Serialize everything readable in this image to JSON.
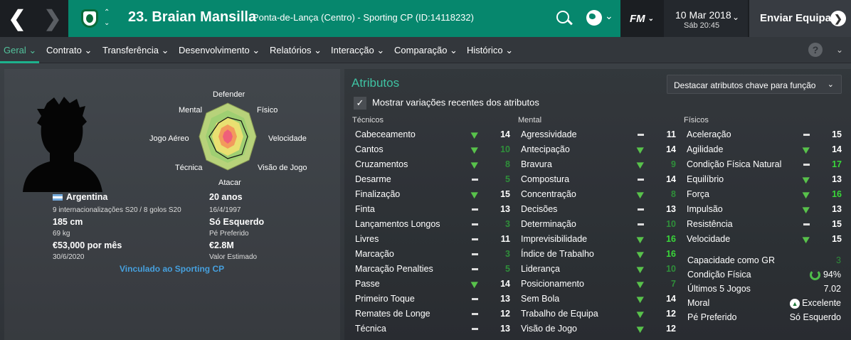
{
  "header": {
    "player_title": "23. Braian Mansilla",
    "player_subtitle": "Ponta-de-Lança (Centro) - Sporting CP (ID:14118232)",
    "fm_label": "FM",
    "date": "10 Mar 2018",
    "time": "Sáb 20:45",
    "send_label": "Enviar Equipa"
  },
  "menu": [
    {
      "label": "Geral"
    },
    {
      "label": "Contrato"
    },
    {
      "label": "Transferência"
    },
    {
      "label": "Desenvolvimento"
    },
    {
      "label": "Relatórios"
    },
    {
      "label": "Interacção"
    },
    {
      "label": "Comparação"
    },
    {
      "label": "Histórico"
    }
  ],
  "help": "?",
  "radar_labels": {
    "top": "Defender",
    "tl": "Mental",
    "tr": "Físico",
    "l": "Jogo Aéreo",
    "r": "Velocidade",
    "bl": "Técnica",
    "br": "Visão de Jogo",
    "bottom": "Atacar"
  },
  "profile": {
    "nation": "Argentina",
    "caps": "9 internacionalizações S20 / 8 golos S20",
    "height": "185 cm",
    "weight": "69 kg",
    "wage": "€53,000 por mês",
    "contract": "30/6/2020",
    "age": "20 anos",
    "dob": "16/4/1997",
    "foot": "Só Esquerdo",
    "foot_label": "Pé Preferido",
    "value": "€2.8M",
    "value_label": "Valor Estimado",
    "linked": "Vinculado ao Sporting CP"
  },
  "attributes": {
    "title": "Atributos",
    "highlight": "Destacar atributos chave para função",
    "show_changes": "Mostrar variações recentes dos atributos",
    "headers": [
      "Técnicos",
      "Mental",
      "Físicos"
    ],
    "technical": [
      {
        "name": "Cabeceamento",
        "value": "14",
        "trend": "up",
        "color": "#ffffff"
      },
      {
        "name": "Cantos",
        "value": "10",
        "trend": "up",
        "color": "#2f8f3a"
      },
      {
        "name": "Cruzamentos",
        "value": "8",
        "trend": "up",
        "color": "#2f8f3a"
      },
      {
        "name": "Desarme",
        "value": "5",
        "trend": "flat",
        "color": "#2f8f3a"
      },
      {
        "name": "Finalização",
        "value": "15",
        "trend": "up",
        "color": "#ffffff"
      },
      {
        "name": "Finta",
        "value": "13",
        "trend": "flat",
        "color": "#ffffff"
      },
      {
        "name": "Lançamentos Longos",
        "value": "3",
        "trend": "flat",
        "color": "#2f8f3a"
      },
      {
        "name": "Livres",
        "value": "11",
        "trend": "flat",
        "color": "#ffffff"
      },
      {
        "name": "Marcação",
        "value": "3",
        "trend": "flat",
        "color": "#2f8f3a"
      },
      {
        "name": "Marcação Penalties",
        "value": "5",
        "trend": "flat",
        "color": "#2f8f3a"
      },
      {
        "name": "Passe",
        "value": "14",
        "trend": "up",
        "color": "#ffffff"
      },
      {
        "name": "Primeiro Toque",
        "value": "13",
        "trend": "flat",
        "color": "#ffffff"
      },
      {
        "name": "Remates de Longe",
        "value": "12",
        "trend": "flat",
        "color": "#ffffff"
      },
      {
        "name": "Técnica",
        "value": "13",
        "trend": "flat",
        "color": "#ffffff"
      }
    ],
    "mental": [
      {
        "name": "Agressividade",
        "value": "11",
        "trend": "flat",
        "color": "#ffffff"
      },
      {
        "name": "Antecipação",
        "value": "14",
        "trend": "up",
        "color": "#ffffff"
      },
      {
        "name": "Bravura",
        "value": "9",
        "trend": "up",
        "color": "#2f8f3a"
      },
      {
        "name": "Compostura",
        "value": "14",
        "trend": "flat",
        "color": "#ffffff"
      },
      {
        "name": "Concentração",
        "value": "8",
        "trend": "up",
        "color": "#2f8f3a"
      },
      {
        "name": "Decisões",
        "value": "13",
        "trend": "flat",
        "color": "#ffffff"
      },
      {
        "name": "Determinação",
        "value": "10",
        "trend": "flat",
        "color": "#2f8f3a"
      },
      {
        "name": "Imprevisibilidade",
        "value": "16",
        "trend": "up",
        "color": "#39d739"
      },
      {
        "name": "Índice de Trabalho",
        "value": "16",
        "trend": "up",
        "color": "#39d739"
      },
      {
        "name": "Liderança",
        "value": "10",
        "trend": "up",
        "color": "#2f8f3a"
      },
      {
        "name": "Posicionamento",
        "value": "7",
        "trend": "up",
        "color": "#2f8f3a"
      },
      {
        "name": "Sem Bola",
        "value": "14",
        "trend": "up",
        "color": "#ffffff"
      },
      {
        "name": "Trabalho de Equipa",
        "value": "12",
        "trend": "up",
        "color": "#ffffff"
      },
      {
        "name": "Visão de Jogo",
        "value": "12",
        "trend": "up",
        "color": "#ffffff"
      }
    ],
    "physical": [
      {
        "name": "Aceleração",
        "value": "15",
        "trend": "flat",
        "color": "#ffffff"
      },
      {
        "name": "Agilidade",
        "value": "14",
        "trend": "up",
        "color": "#ffffff"
      },
      {
        "name": "Condição Física Natural",
        "value": "17",
        "trend": "flat",
        "color": "#39d739"
      },
      {
        "name": "Equilíbrio",
        "value": "13",
        "trend": "up",
        "color": "#ffffff"
      },
      {
        "name": "Força",
        "value": "16",
        "trend": "up",
        "color": "#39d739"
      },
      {
        "name": "Impulsão",
        "value": "13",
        "trend": "up",
        "color": "#ffffff"
      },
      {
        "name": "Resistência",
        "value": "15",
        "trend": "flat",
        "color": "#ffffff"
      },
      {
        "name": "Velocidade",
        "value": "15",
        "trend": "up",
        "color": "#ffffff"
      }
    ]
  },
  "status": [
    {
      "label": "Capacidade como GR",
      "value": "3",
      "color": "#2f8f3a"
    },
    {
      "label": "Condição Física",
      "value": "94%",
      "color": "#ffffff",
      "icon": "fitness-ring"
    },
    {
      "label": "Últimos 5 Jogos",
      "value": "7.02",
      "color": "#ffffff"
    },
    {
      "label": "Moral",
      "value": "Excelente",
      "color": "#ffffff",
      "icon": "morale-up"
    },
    {
      "label": "Pé Preferido",
      "value": "Só Esquerdo",
      "color": "#ffffff"
    }
  ]
}
